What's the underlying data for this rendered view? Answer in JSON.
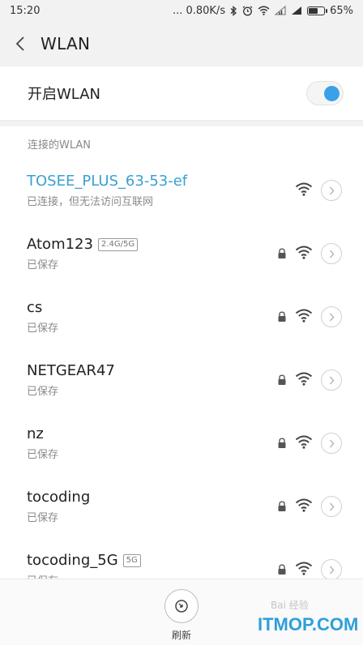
{
  "status_bar": {
    "time": "15:20",
    "network_speed": "... 0.80K/s",
    "battery_percent": "65%",
    "battery_level": 0.65
  },
  "header": {
    "title": "WLAN"
  },
  "toggle": {
    "label": "开启WLAN",
    "on": true
  },
  "section_title": "连接的WLAN",
  "networks": [
    {
      "name": "TOSEE_PLUS_63-53-ef",
      "status": "已连接，但无法访问互联网",
      "band": "",
      "locked": false,
      "connected": true
    },
    {
      "name": "Atom123",
      "status": "已保存",
      "band": "2.4G/5G",
      "locked": true,
      "connected": false
    },
    {
      "name": "cs",
      "status": "已保存",
      "band": "",
      "locked": true,
      "connected": false
    },
    {
      "name": "NETGEAR47",
      "status": "已保存",
      "band": "",
      "locked": true,
      "connected": false
    },
    {
      "name": "nz",
      "status": "已保存",
      "band": "",
      "locked": true,
      "connected": false
    },
    {
      "name": "tocoding",
      "status": "已保存",
      "band": "",
      "locked": true,
      "connected": false
    },
    {
      "name": "tocoding_5G",
      "status": "已保存",
      "band": "5G",
      "locked": true,
      "connected": false
    }
  ],
  "bottom": {
    "refresh_label": "刷新"
  },
  "watermark": {
    "text": "ITMOP.COM",
    "baidu": "Bai 经验"
  },
  "colors": {
    "accent": "#3aa0e8",
    "watermark": "#2e9fd8"
  }
}
